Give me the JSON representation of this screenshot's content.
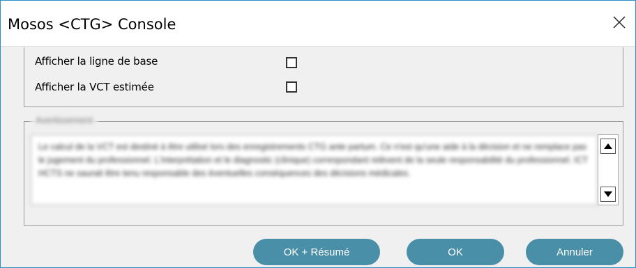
{
  "window": {
    "title": "Mosos <CTG> Console"
  },
  "options": {
    "baseline_label": "Afficher la ligne de base",
    "baseline_checked": false,
    "vct_label": "Afficher la VCT estimée",
    "vct_checked": false
  },
  "disclaimer": {
    "legend": "Avertissement",
    "text": "Le calcul de la VCT est destiné à être utilisé lors des enregistrements CTG ante partum. Ce n'est qu'une aide à la décision et ne remplace pas le jugement du professionnel. L'interprétation et le diagnostic (clinique) correspondant relèvent de la seule responsabilité du professionnel. ICT HCTS ne saurait être tenu responsable des éventuelles conséquences des décisions médicales."
  },
  "buttons": {
    "ok_summary": "OK + Résumé",
    "ok": "OK",
    "cancel": "Annuler"
  },
  "colors": {
    "button_bg": "#4a8fa8",
    "window_border": "#2a8fc4",
    "dialog_bg": "#f0f0f0"
  }
}
